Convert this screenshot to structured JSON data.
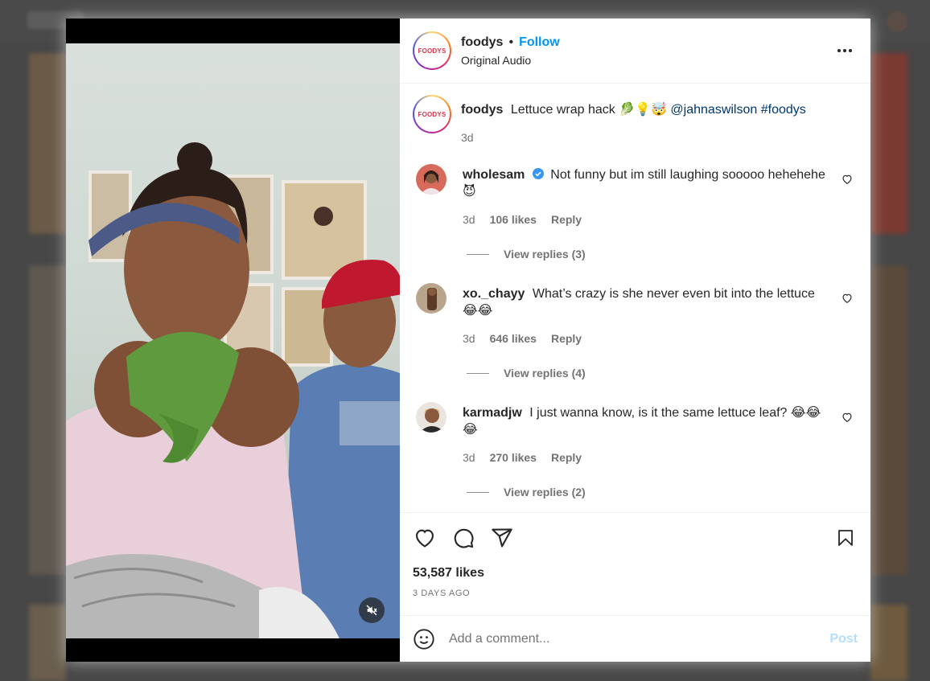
{
  "post": {
    "username": "foodys",
    "separator": "•",
    "follow_label": "Follow",
    "audio": "Original Audio",
    "brand_text": "FOODYS"
  },
  "caption": {
    "username": "foodys",
    "text": "Lettuce wrap hack 🥬💡🤯",
    "mention": "@jahnaswilson",
    "hashtag": "#foodys",
    "age": "3d"
  },
  "comments": [
    {
      "username": "wholesam",
      "verified": true,
      "text": "Not funny but im still laughing sooooo hehehehe 😈",
      "age": "3d",
      "likes": "106 likes",
      "reply": "Reply",
      "view_replies": "View replies (3)"
    },
    {
      "username": "xo._chayy",
      "verified": false,
      "text": "What’s crazy is she never even bit into the lettuce😂😂",
      "age": "3d",
      "likes": "646 likes",
      "reply": "Reply",
      "view_replies": "View replies (4)"
    },
    {
      "username": "karmadjw",
      "verified": false,
      "text": "I just wanna know, is it the same lettuce leaf? 😂😂😂",
      "age": "3d",
      "likes": "270 likes",
      "reply": "Reply",
      "view_replies": "View replies (2)"
    }
  ],
  "stats": {
    "likes": "53,587 likes",
    "date": "3 DAYS AGO"
  },
  "add_comment": {
    "placeholder": "Add a comment...",
    "post_label": "Post"
  },
  "colors": {
    "accent": "#0095f6",
    "post_disabled": "#b2dffc",
    "muted_text": "#737373",
    "verified": "#3897f0"
  },
  "icons": [
    "more-icon",
    "heart-icon",
    "comment-icon",
    "share-icon",
    "save-icon",
    "smiley-icon",
    "mute-icon",
    "verified-icon"
  ]
}
